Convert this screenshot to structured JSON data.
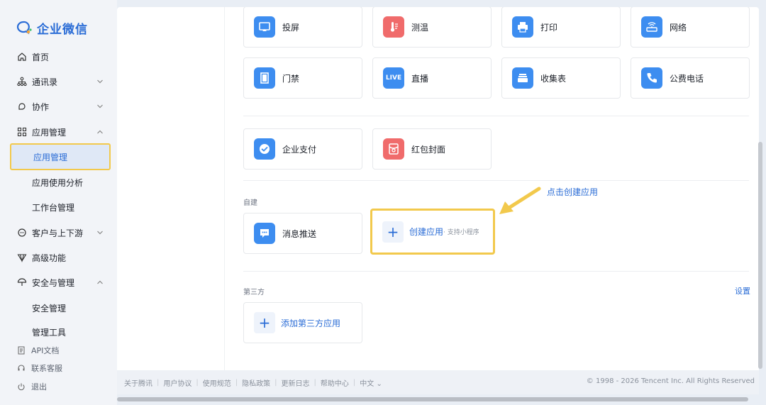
{
  "brand": {
    "name": "企业微信"
  },
  "nav": {
    "home": "首页",
    "contacts": "通讯录",
    "collab": "协作",
    "app_mgmt": "应用管理",
    "app_mgmt_sub": "应用管理",
    "app_usage": "应用使用分析",
    "workbench": "工作台管理",
    "customers": "客户与上下游",
    "advanced": "高级功能",
    "security": "安全与管理",
    "security_sub": "安全管理",
    "tools": "管理工具"
  },
  "nav_footer": {
    "api": "API文档",
    "support": "联系客服",
    "logout": "退出"
  },
  "apps_row1": [
    "投屏",
    "测温",
    "打印",
    "网络"
  ],
  "apps_row2": [
    "门禁",
    "直播",
    "收集表",
    "公费电话"
  ],
  "apps_row3": [
    "企业支付",
    "红包封面"
  ],
  "live_badge": "LIVE",
  "self_built": {
    "label": "自建",
    "message_push": "消息推送",
    "create_app": "创建应用",
    "create_app_sub": "· 支持小程序"
  },
  "third_party": {
    "label": "第三方",
    "settings": "设置",
    "add": "添加第三方应用"
  },
  "annotation": "点击创建应用",
  "footer": {
    "links": [
      "关于腾讯",
      "用户协议",
      "使用规范",
      "隐私政策",
      "更新日志",
      "帮助中心"
    ],
    "lang": "中文",
    "copyright": "© 1998 - 2026 Tencent Inc. All Rights Reserved"
  },
  "colors": {
    "accent": "#2a6cd6",
    "highlight": "#f2c94c",
    "red_icon": "#f06b6b",
    "blue_icon": "#3d8df0"
  }
}
